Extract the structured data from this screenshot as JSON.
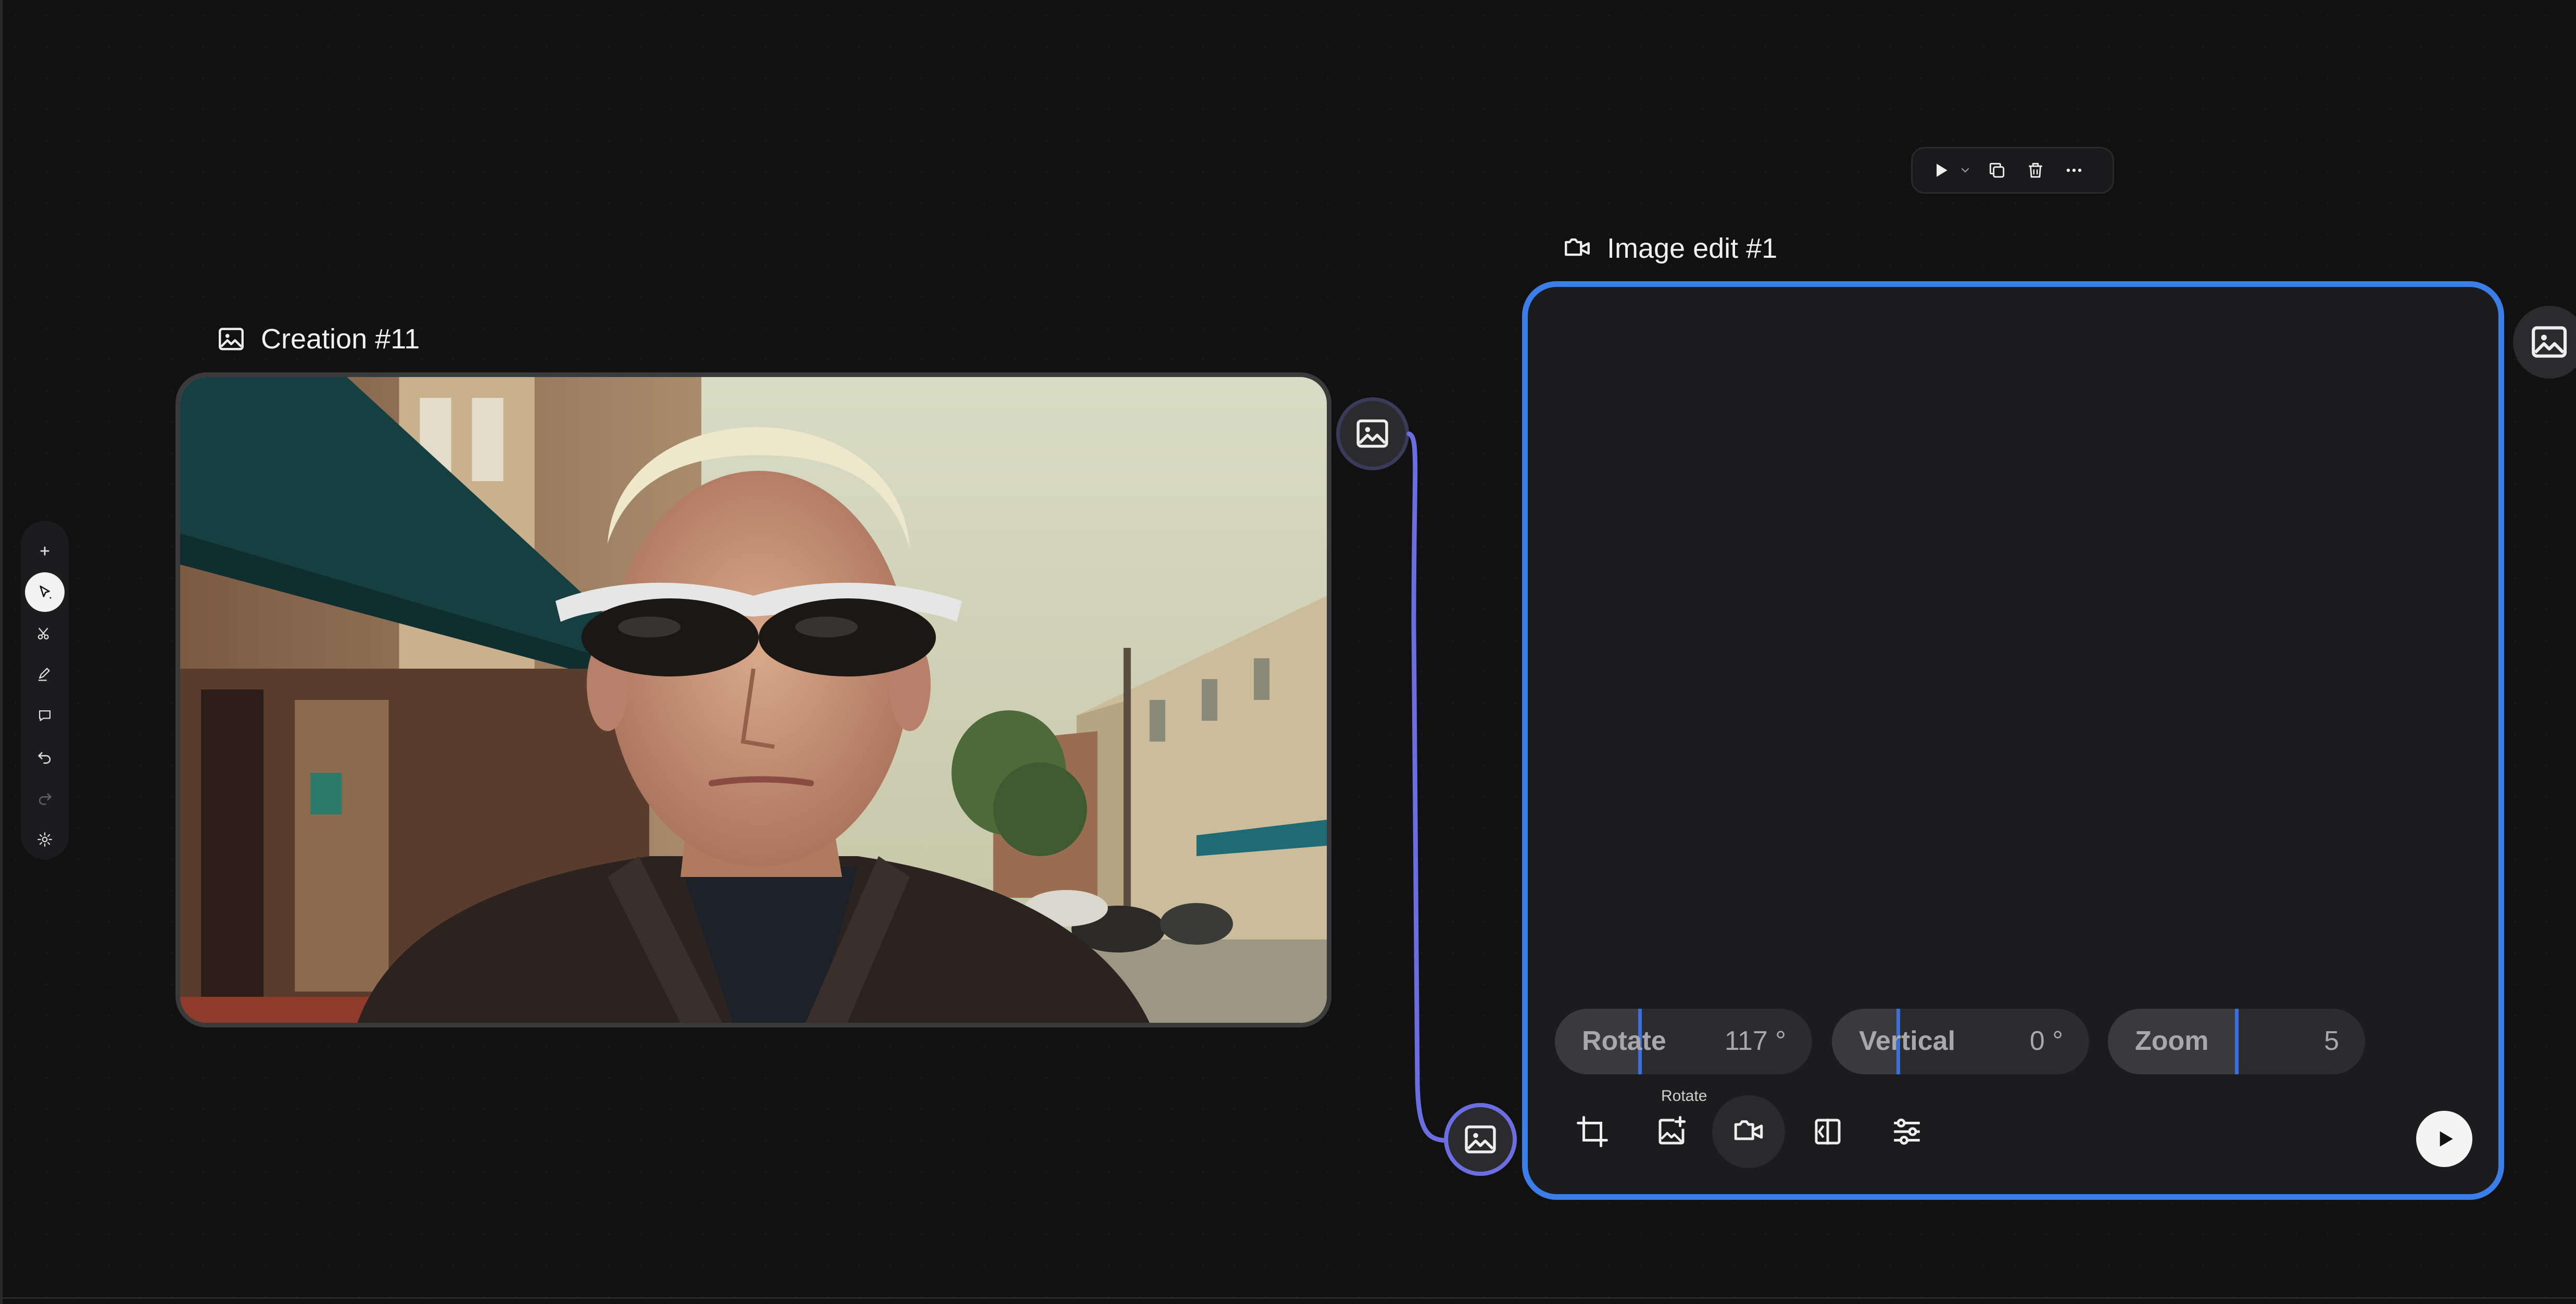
{
  "toolbar": {
    "items": [
      {
        "name": "add",
        "icon": "plus-icon"
      },
      {
        "name": "select",
        "icon": "cursor-icon",
        "active": true
      },
      {
        "name": "cut",
        "icon": "scissors-icon"
      },
      {
        "name": "draw",
        "icon": "pen-icon"
      },
      {
        "name": "comment",
        "icon": "comment-icon"
      },
      {
        "name": "undo",
        "icon": "undo-icon"
      },
      {
        "name": "redo",
        "icon": "redo-icon",
        "disabled": true
      },
      {
        "name": "settings",
        "icon": "gear-icon"
      }
    ]
  },
  "creation_node": {
    "title": "Creation #11",
    "icon": "image-icon",
    "image_description": "blond man with sunglasses on street"
  },
  "edit_node": {
    "title": "Image edit #1",
    "icon": "video-camera-icon",
    "controls": [
      {
        "label": "Rotate",
        "value": "117 °"
      },
      {
        "label": "Vertical",
        "value": "0 °"
      },
      {
        "label": "Zoom",
        "value": "5"
      }
    ],
    "tools": [
      {
        "name": "crop",
        "icon": "crop-icon"
      },
      {
        "name": "rotate",
        "icon": "image-plus-icon"
      },
      {
        "name": "camera",
        "icon": "video-camera-icon",
        "active": true
      },
      {
        "name": "flip",
        "icon": "flip-icon"
      },
      {
        "name": "adjust",
        "icon": "sliders-icon"
      }
    ],
    "tooltip": "Rotate",
    "run_icon": "play-icon"
  },
  "node_toolbar": {
    "items": [
      "play-icon",
      "chevron-down-icon",
      "duplicate-icon",
      "trash-icon",
      "more-icon"
    ]
  },
  "colors": {
    "accent": "#3b7ee8",
    "edge": "#6a6ee0",
    "background": "#111112"
  }
}
